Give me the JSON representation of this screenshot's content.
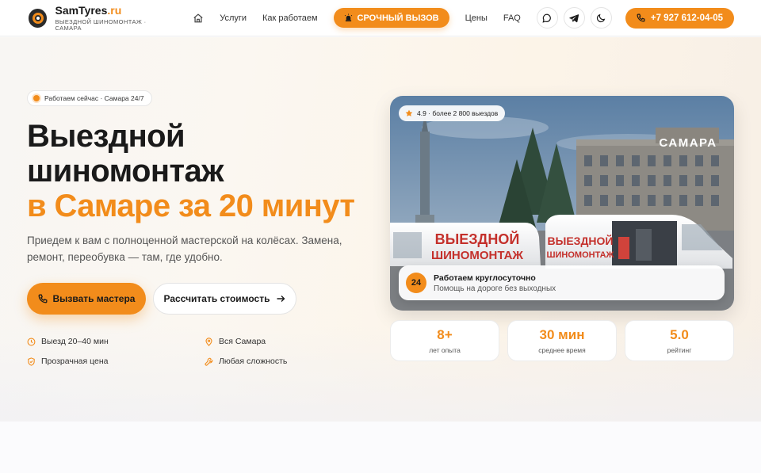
{
  "brand": {
    "name": "SamTyres",
    "tld": ".ru",
    "subtitle": "ВЫЕЗДНОЙ ШИНОМОНТАЖ · САМАРА"
  },
  "nav": {
    "links": [
      "Услуги",
      "Как работаем",
      "Цены",
      "FAQ"
    ],
    "urgent_label": "СРОЧНЫЙ ВЫЗОВ"
  },
  "header": {
    "phone": "+7 927 612-04-05"
  },
  "hero": {
    "badge": "Работаем сейчас · Самара 24/7",
    "title_line1": "Выездной",
    "title_line2": "шиномонтаж",
    "title_line3": "в Самаре за 20 минут",
    "lead": "Приедем к вам с полноценной мастерской на колёсах. Замена, ремонт, переобувка — там, где удобно.",
    "cta_primary": "Вызвать мастера",
    "cta_secondary": "Рассчитать стоимость",
    "features": [
      "Выезд 20–40 мин",
      "Вся Самара",
      "Прозрачная цена",
      "Любая сложность"
    ]
  },
  "photo": {
    "rating": "4.9 · более 2 800 выездов",
    "sign_text": "САМАРА",
    "van_text_line1": "ВЫЕЗДНОЙ",
    "van_text_line2": "ШИНОМОНТАЖ",
    "info_number": "24",
    "info_title": "Работаем круглосуточно",
    "info_sub": "Помощь на дороге без выходных"
  },
  "stats": [
    {
      "value": "8+",
      "label": "лет опыта"
    },
    {
      "value": "30 мин",
      "label": "среднее время"
    },
    {
      "value": "5.0",
      "label": "рейтинг"
    }
  ],
  "colors": {
    "accent": "#f28c1b",
    "text": "#1a1a1a",
    "muted": "#555555"
  }
}
